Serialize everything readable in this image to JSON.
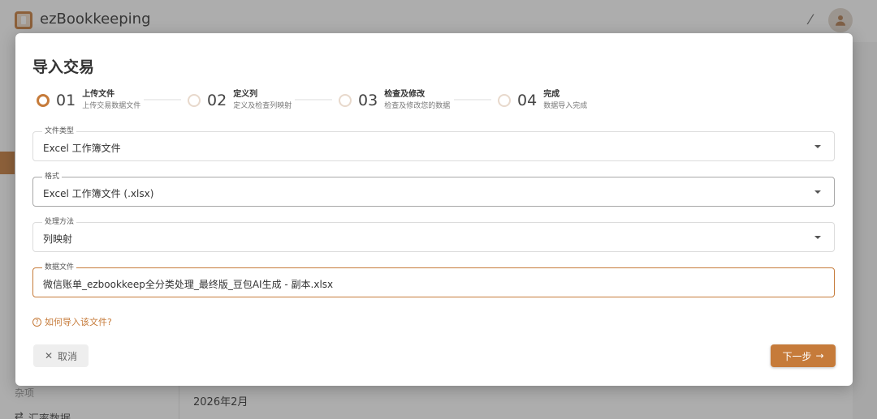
{
  "app": {
    "title": "ezBookkeeping",
    "magic_icon": "magic-wand-off-icon",
    "avatar_icon": "user-icon"
  },
  "background": {
    "sidebar_section": "杂项",
    "sidebar_item_label": "汇率数据",
    "month_label": "2026年2月"
  },
  "dialog": {
    "title": "导入交易",
    "steps": [
      {
        "num": "01",
        "title": "上传文件",
        "subtitle": "上传交易数据文件",
        "active": true
      },
      {
        "num": "02",
        "title": "定义列",
        "subtitle": "定义及检查列映射",
        "active": false
      },
      {
        "num": "03",
        "title": "检查及修改",
        "subtitle": "检查及修改您的数据",
        "active": false
      },
      {
        "num": "04",
        "title": "完成",
        "subtitle": "数据导入完成",
        "active": false
      }
    ],
    "fields": {
      "file_type": {
        "label": "文件类型",
        "value": "Excel 工作簿文件"
      },
      "format": {
        "label": "格式",
        "value": "Excel 工作簿文件 (.xlsx)"
      },
      "process_method": {
        "label": "处理方法",
        "value": "列映射"
      },
      "data_file": {
        "label": "数据文件",
        "value": "微信账单_ezbookkeep全分类处理_最终版_豆包AI生成 - 副本.xlsx"
      }
    },
    "help_link": "如何导入该文件?",
    "cancel_label": "取消",
    "next_label": "下一步"
  },
  "colors": {
    "accent": "#c67b3a"
  }
}
